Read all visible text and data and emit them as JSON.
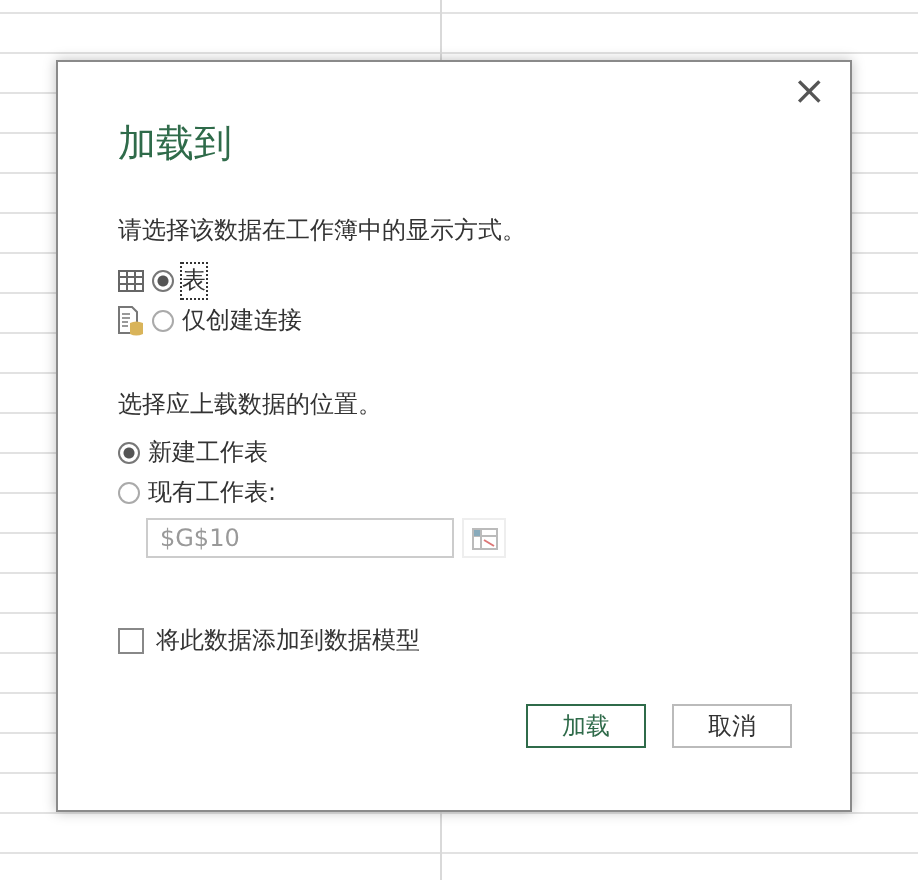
{
  "dialog": {
    "title": "加载到",
    "close": "×",
    "display_prompt": "请选择该数据在工作簿中的显示方式。",
    "display_options": [
      {
        "kind": "table",
        "label": "表",
        "selected": true
      },
      {
        "kind": "connection",
        "label": "仅创建连接",
        "selected": false
      }
    ],
    "location_prompt": "选择应上载数据的位置。",
    "location_options": [
      {
        "label": "新建工作表",
        "selected": true
      },
      {
        "label": "现有工作表:",
        "selected": false
      }
    ],
    "cell_reference": {
      "value": "$G$10",
      "disabled": true
    },
    "data_model": {
      "label": "将此数据添加到数据模型",
      "checked": false
    },
    "buttons": [
      {
        "label": "加载",
        "primary": true
      },
      {
        "label": "取消",
        "primary": false
      }
    ]
  }
}
